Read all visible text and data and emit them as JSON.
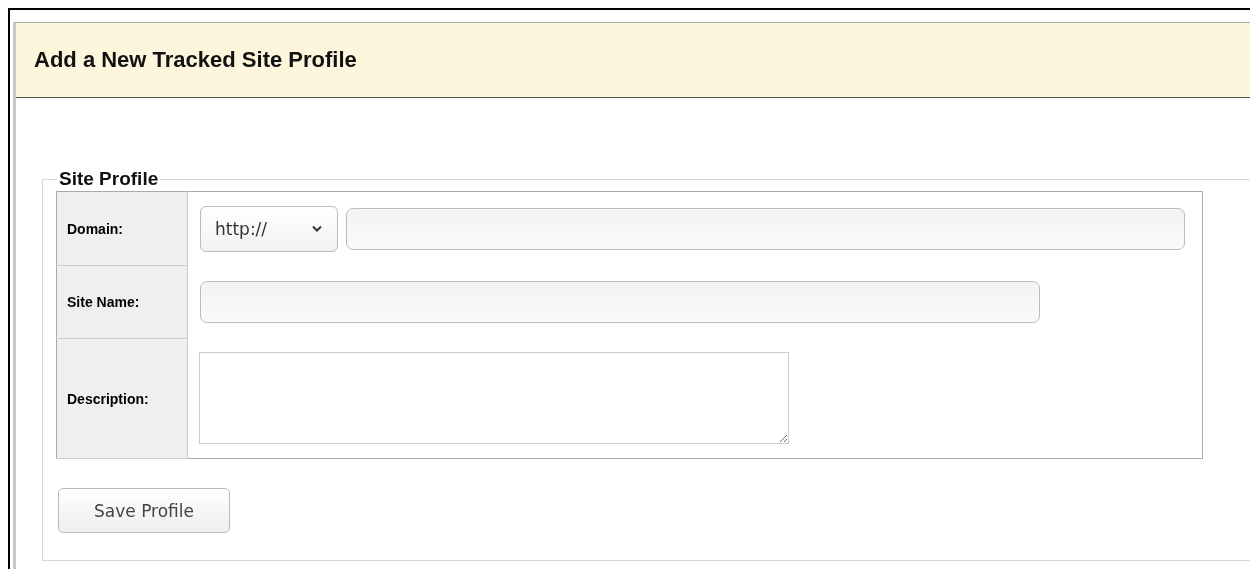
{
  "page": {
    "title": "Add a New Tracked Site Profile"
  },
  "fieldset": {
    "legend": "Site Profile",
    "rows": [
      {
        "label": "Domain:",
        "kind": "url",
        "protocol": "http://"
      },
      {
        "label": "Site Name:",
        "kind": "text"
      },
      {
        "label": "Description:",
        "kind": "textarea"
      }
    ]
  },
  "buttons": [
    "Save Profile"
  ]
}
